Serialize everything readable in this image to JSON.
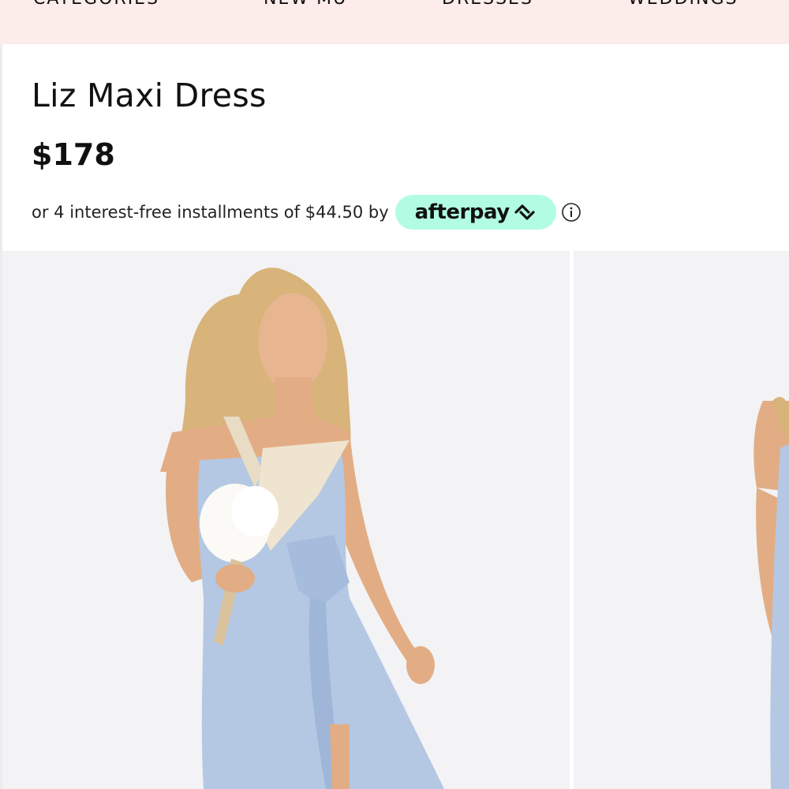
{
  "nav": {
    "items": [
      "CATEGORIES",
      "NEW MU",
      "DRESSES",
      "WEDDINGS"
    ]
  },
  "product": {
    "title": "Liz Maxi Dress",
    "price": "$178",
    "installment_text": "or 4 interest-free installments of $44.50 by",
    "afterpay_label": "afterpay",
    "afterpay_color": "#b2fce4"
  },
  "icons": {
    "afterpay_logo": "afterpay-arrows-icon",
    "info": "info-circle-icon"
  },
  "gallery": {
    "images": [
      "model-photo-main",
      "model-photo-next"
    ]
  }
}
